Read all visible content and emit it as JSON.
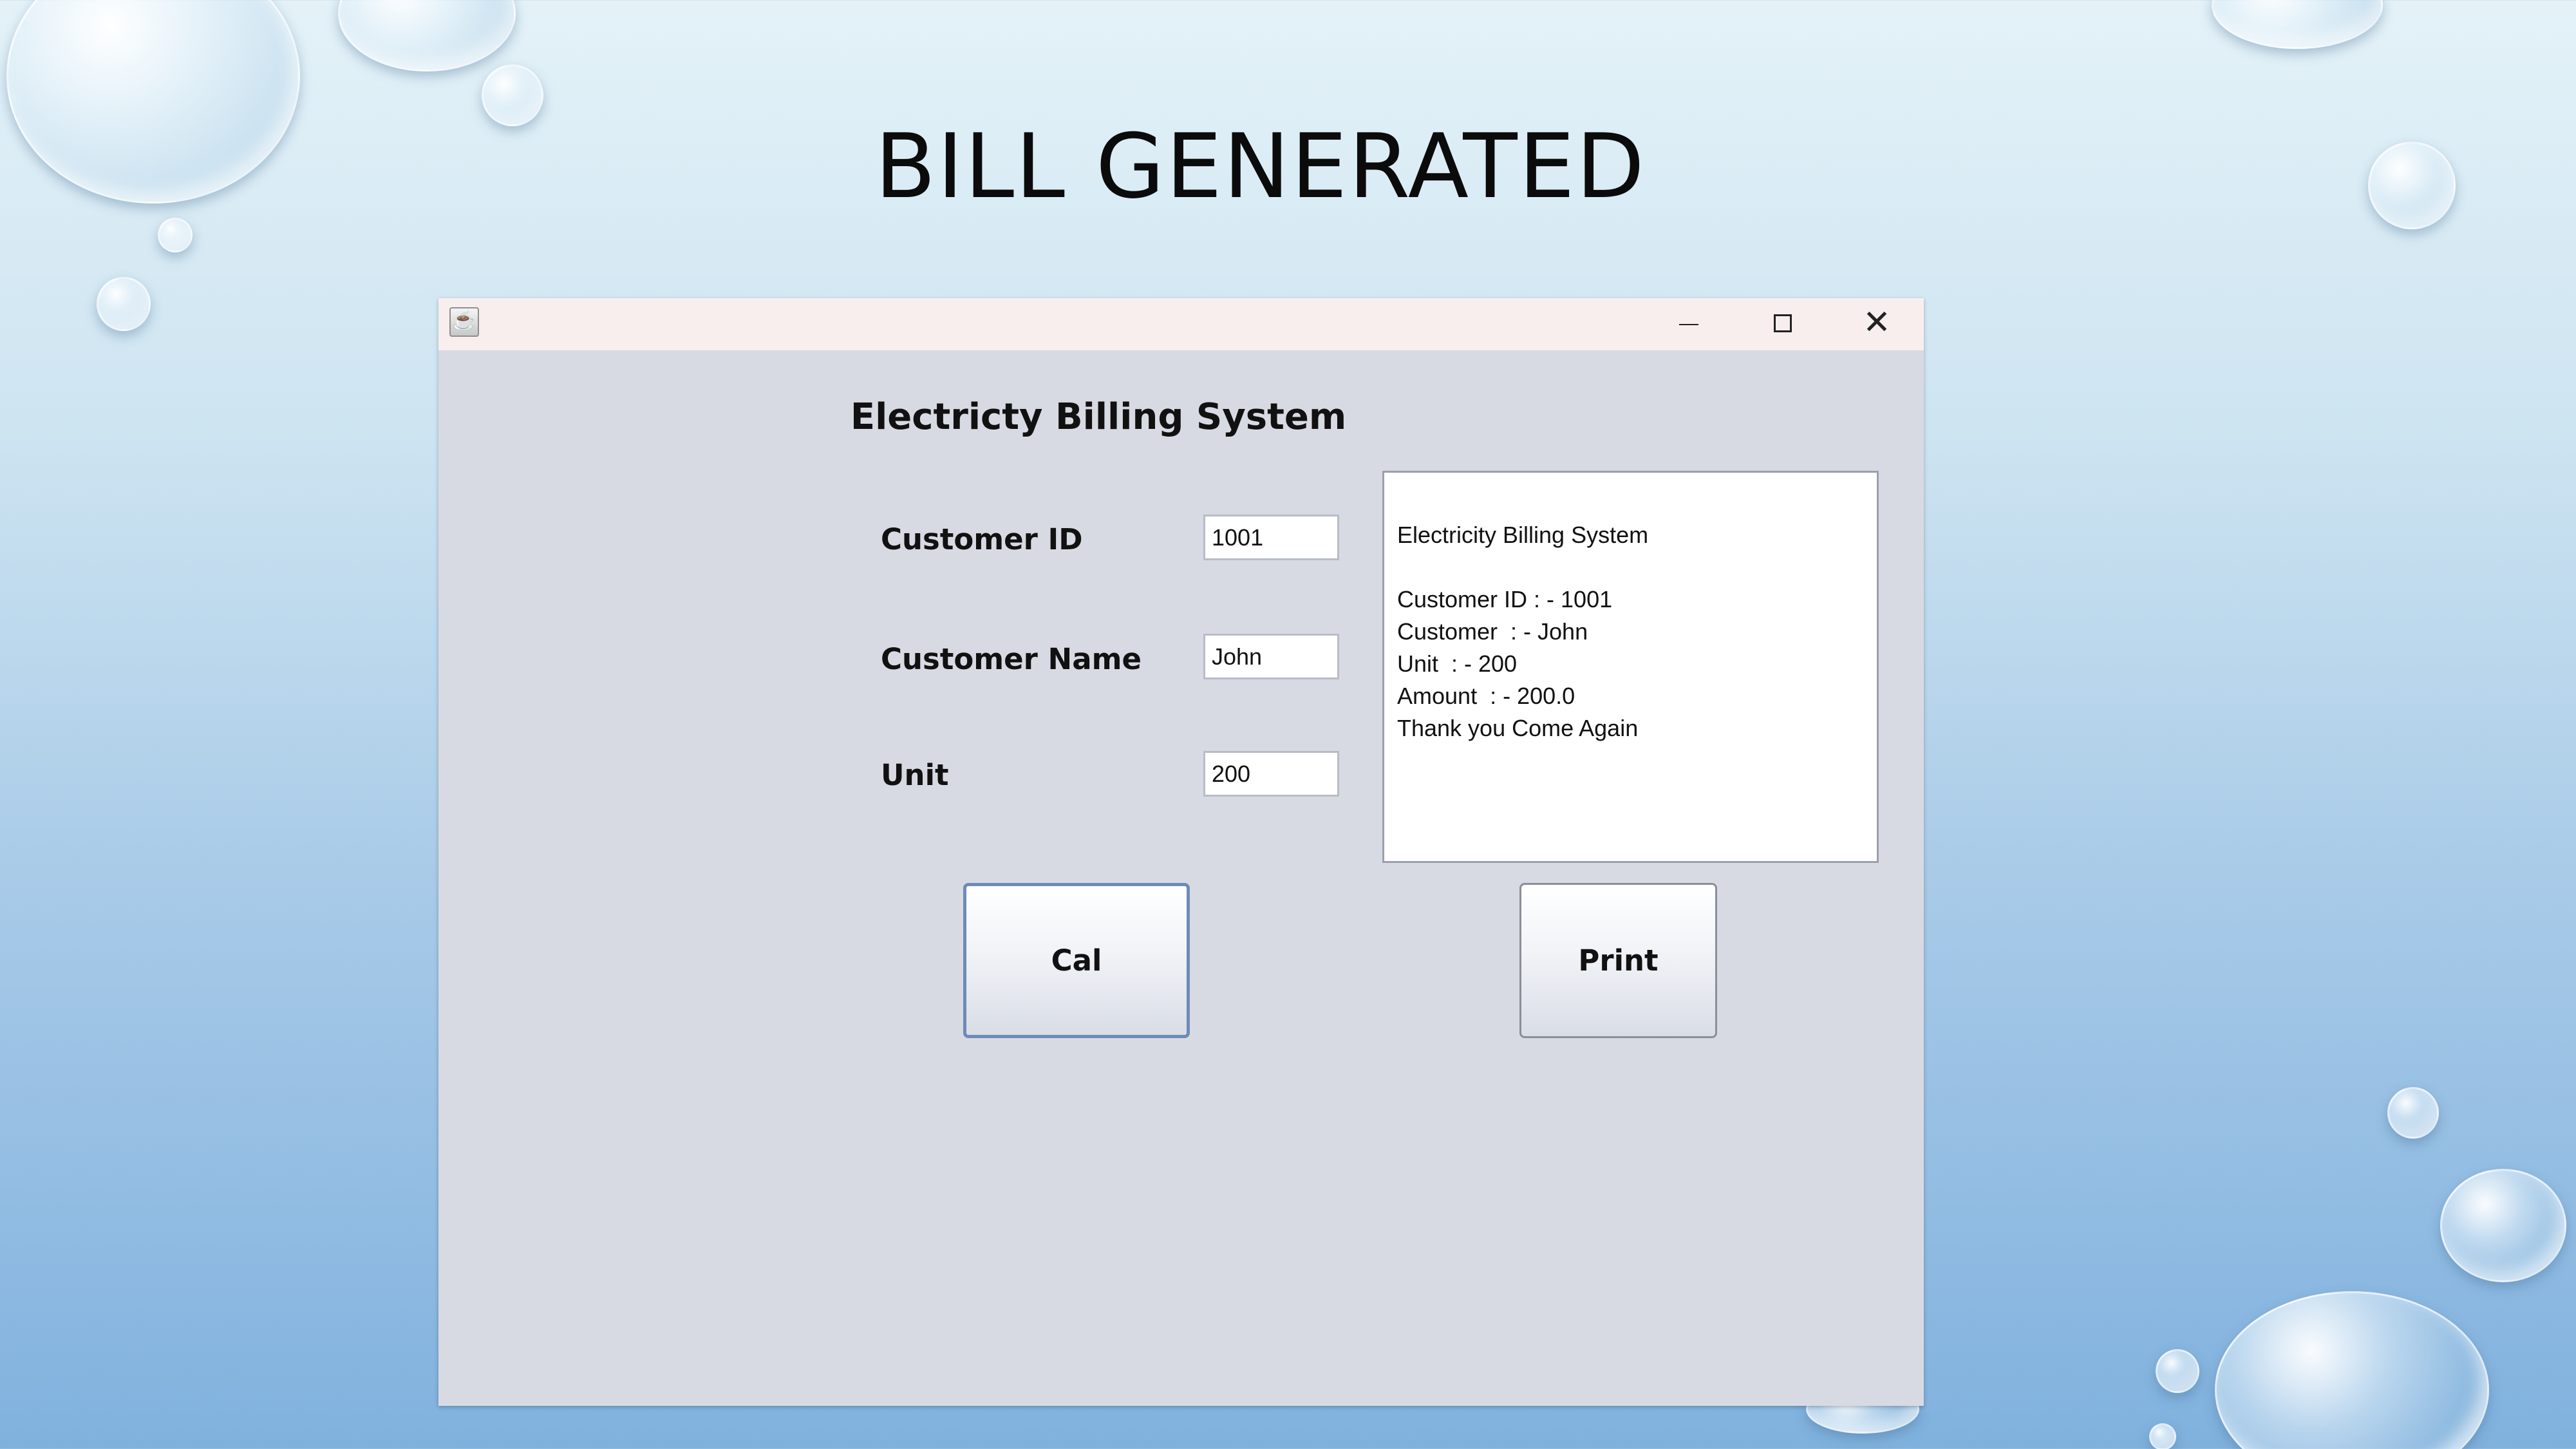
{
  "slide": {
    "title": "BILL GENERATED"
  },
  "window": {
    "app_icon": "java-cup-icon",
    "minimize_icon": "minimize-icon",
    "maximize_icon": "maximize-icon",
    "close_icon": "close-icon",
    "close_glyph": "✕"
  },
  "app": {
    "heading": "Electricty Billing System",
    "fields": {
      "customer_id_label": "Customer ID",
      "customer_id_value": "1001",
      "customer_name_label": "Customer Name",
      "customer_name_value": "John",
      "unit_label": "Unit",
      "unit_value": "200"
    },
    "bill": {
      "lines": [
        "Electricity Billing System",
        "",
        "Customer ID : - 1001",
        "Customer  : - John",
        "Unit  : - 200",
        "Amount  : - 200.0",
        "Thank you Come Again"
      ]
    },
    "buttons": {
      "cal_label": "Cal",
      "print_label": "Print"
    }
  },
  "colors": {
    "window_bg": "#d8dae3",
    "titlebar_bg": "#f9eeee",
    "focus_border": "#6d8bb8"
  }
}
